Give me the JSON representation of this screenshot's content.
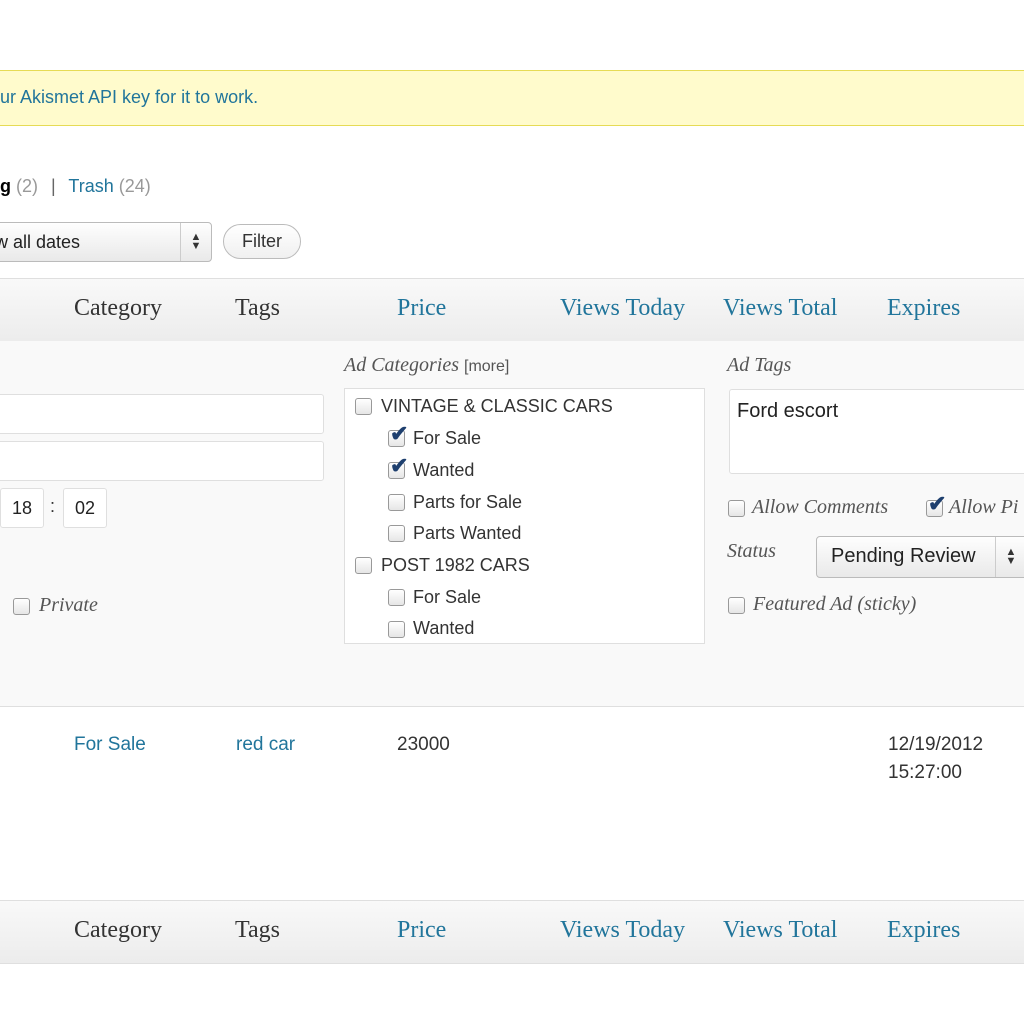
{
  "notice": {
    "text": "ur Akismet API key for it to work."
  },
  "status_links": {
    "current_label": "g",
    "current_count": "(2)",
    "separator": "|",
    "trash_label": "Trash",
    "trash_count": "(24)"
  },
  "filters": {
    "date_selected": "w all dates",
    "filter_button": "Filter"
  },
  "columns": {
    "category": "Category",
    "tags": "Tags",
    "price": "Price",
    "views_today": "Views Today",
    "views_total": "Views Total",
    "expires": "Expires"
  },
  "quick_edit": {
    "time_hour": "18",
    "time_sep": ":",
    "time_minute": "02",
    "private_label": "Private",
    "categories_title": "Ad Categories",
    "categories_more": "[more]",
    "categories": [
      {
        "label": "VINTAGE & CLASSIC CARS",
        "checked": false
      },
      {
        "label": "For Sale",
        "checked": true
      },
      {
        "label": "Wanted",
        "checked": true
      },
      {
        "label": "Parts for Sale",
        "checked": false
      },
      {
        "label": "Parts Wanted",
        "checked": false
      },
      {
        "label": "POST 1982 CARS",
        "checked": false
      },
      {
        "label": "For Sale",
        "checked": false
      },
      {
        "label": "Wanted",
        "checked": false
      }
    ],
    "tags_title": "Ad Tags",
    "tags_value": "Ford escort",
    "allow_comments_label": "Allow Comments",
    "allow_pings_label": "Allow Pi",
    "status_label": "Status",
    "status_value": "Pending Review",
    "featured_label": "Featured Ad (sticky)"
  },
  "rows": [
    {
      "category": "For Sale",
      "tags": "red car",
      "price": "23000",
      "expires_date": "12/19/2012",
      "expires_time": "15:27:00"
    }
  ]
}
